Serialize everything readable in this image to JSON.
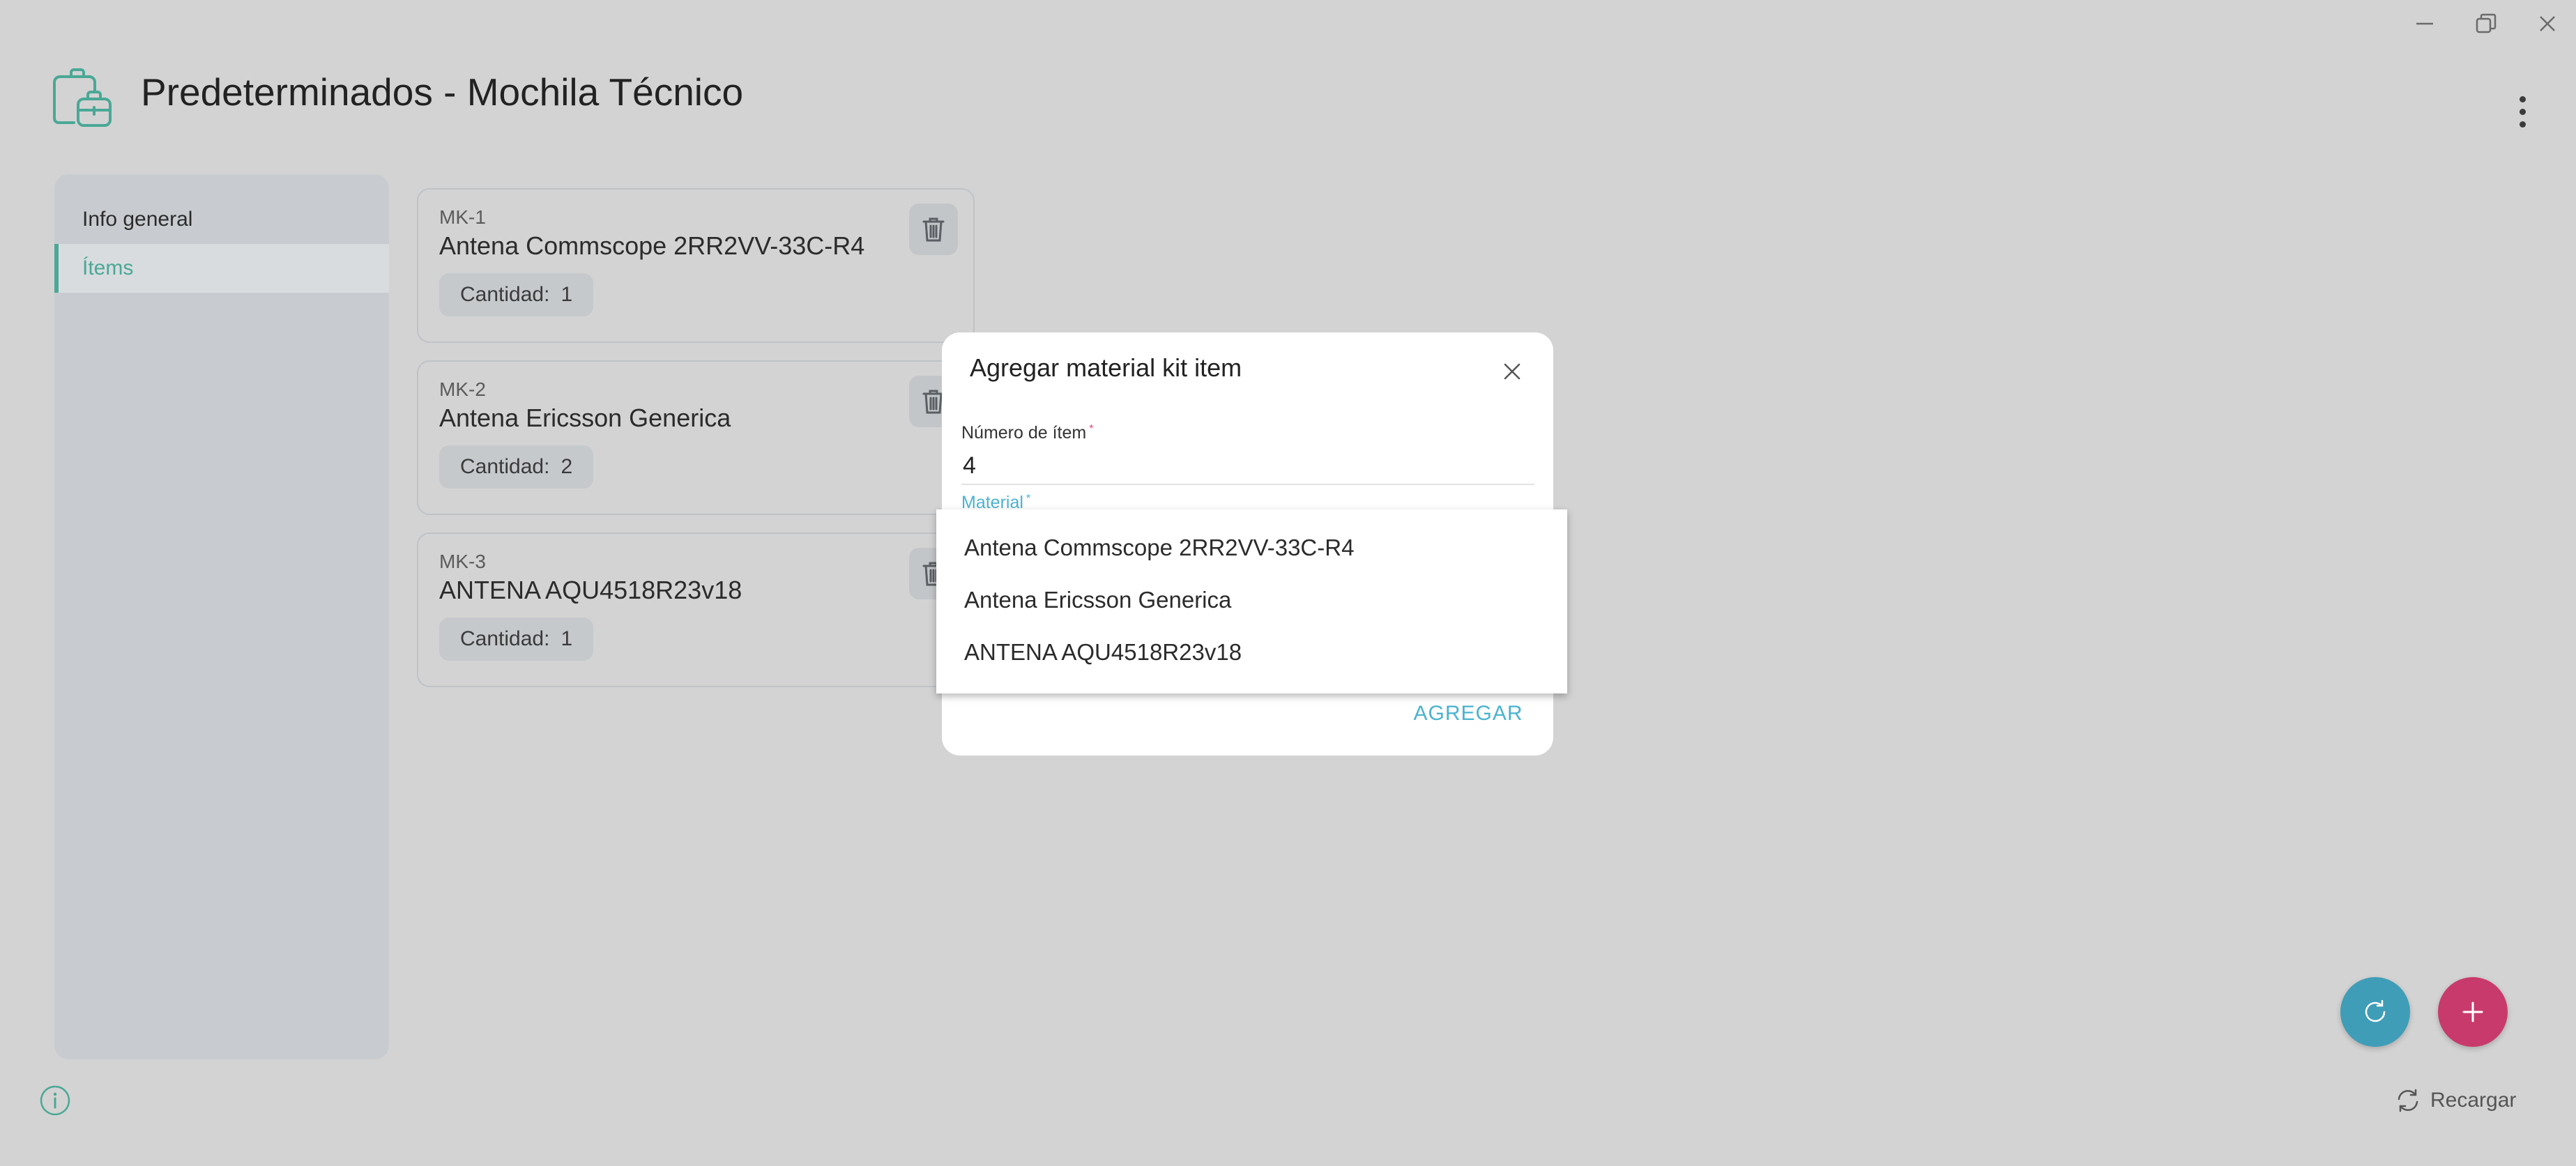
{
  "header": {
    "title": "Predeterminados - Mochila Técnico"
  },
  "sidebar": {
    "items": [
      {
        "label": "Info general"
      },
      {
        "label": "Ítems"
      }
    ]
  },
  "items": [
    {
      "code": "MK-1",
      "name": "Antena Commscope 2RR2VV-33C-R4",
      "qty_label": "Cantidad:",
      "qty": "1"
    },
    {
      "code": "MK-2",
      "name": "Antena Ericsson Generica",
      "qty_label": "Cantidad:",
      "qty": "2"
    },
    {
      "code": "MK-3",
      "name": "ANTENA AQU4518R23v18",
      "qty_label": "Cantidad:",
      "qty": "1"
    }
  ],
  "dialog": {
    "title": "Agregar material kit item",
    "item_number_label": "Número de ítem",
    "item_number_value": "4",
    "material_label": "Material",
    "required_mark": "*",
    "add_label": "AGREGAR"
  },
  "dropdown": {
    "options": [
      "Antena Commscope 2RR2VV-33C-R4",
      "Antena Ericsson Generica",
      "ANTENA AQU4518R23v18"
    ]
  },
  "footer": {
    "reload_label": "Recargar"
  },
  "colors": {
    "accent_teal": "#4aa896",
    "accent_blue": "#4bb3cf",
    "fab_refresh": "#3f9db7",
    "fab_add": "#c93a6c",
    "required": "#e0457b"
  }
}
